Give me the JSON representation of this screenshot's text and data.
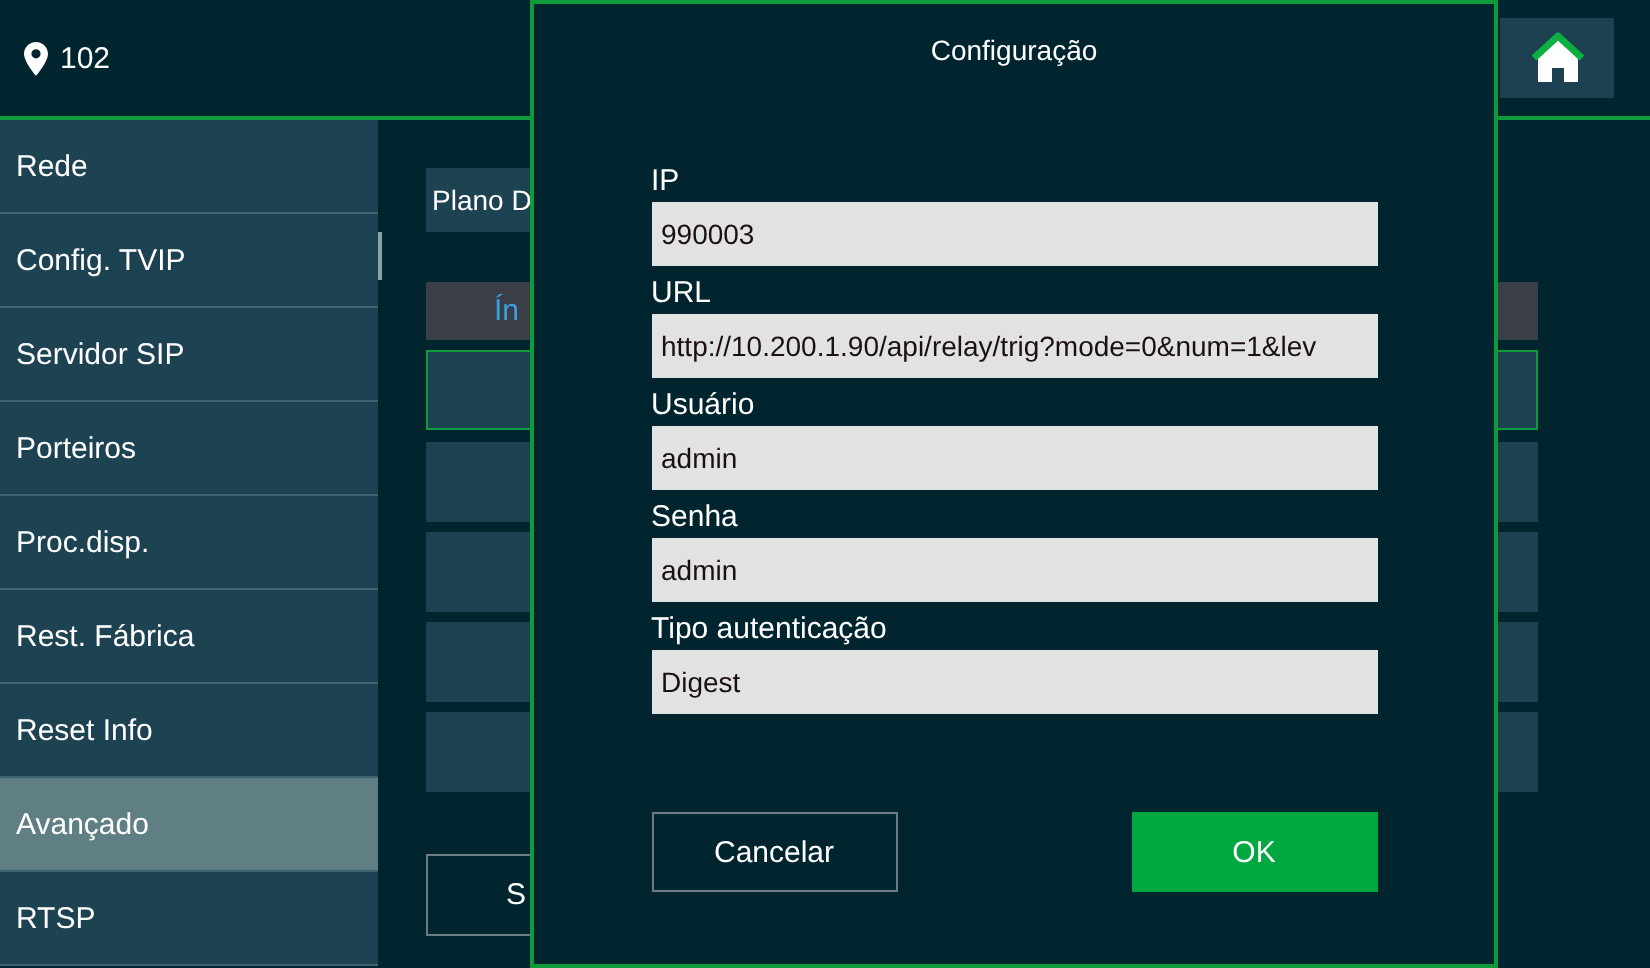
{
  "header": {
    "location": "102"
  },
  "sidebar": {
    "items": [
      {
        "label": "Rede",
        "selected": false
      },
      {
        "label": "Config. TVIP",
        "selected": false
      },
      {
        "label": "Servidor SIP",
        "selected": false
      },
      {
        "label": "Porteiros",
        "selected": false
      },
      {
        "label": "Proc.disp.",
        "selected": false
      },
      {
        "label": "Rest. Fábrica",
        "selected": false
      },
      {
        "label": "Reset Info",
        "selected": false
      },
      {
        "label": "Avançado",
        "selected": true
      },
      {
        "label": "RTSP",
        "selected": false
      }
    ]
  },
  "content": {
    "plan_label": "Plano D",
    "table_header": "Ín",
    "rows": [
      {
        "selected": true
      },
      {
        "selected": false
      },
      {
        "selected": false
      },
      {
        "selected": false
      },
      {
        "selected": false
      }
    ],
    "button": "S"
  },
  "dialog": {
    "title": "Configuração",
    "fields": [
      {
        "label": "IP",
        "value": "990003"
      },
      {
        "label": "URL",
        "value": "http://10.200.1.90/api/relay/trig?mode=0&num=1&lev"
      },
      {
        "label": "Usuário",
        "value": "admin"
      },
      {
        "label": "Senha",
        "value": "admin"
      },
      {
        "label": "Tipo autenticação",
        "value": "Digest"
      }
    ],
    "cancel": "Cancelar",
    "ok": "OK"
  }
}
